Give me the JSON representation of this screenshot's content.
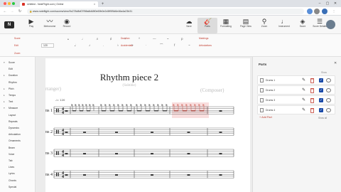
{
  "browser": {
    "tab_title": "Untitled - NoteFlight.com | Online",
    "tab_close": "×",
    "new_tab": "+",
    "url": "www.noteflight.com/scores/view/9c278d8d07f98a8d48f0e69b0e2c5ff0f5d6e46a4a23b31",
    "win_min": "–",
    "win_max": "▢",
    "win_close": "✕",
    "nav_back": "←",
    "nav_forward": "→",
    "nav_reload": "↻",
    "lock": "🔒"
  },
  "app": {
    "logo": "N",
    "tools": [
      {
        "icon": "play-icon",
        "glyph": "▶",
        "label": "Play"
      },
      {
        "icon": "metronome-icon",
        "glyph": "〰",
        "label": "Metronome"
      },
      {
        "icon": "record-icon",
        "glyph": "◉",
        "label": "Record"
      },
      {
        "icon": "save-icon",
        "glyph": "☁",
        "label": "Save"
      },
      {
        "icon": "guitar-icon",
        "glyph": "🎸",
        "label": "Parts"
      },
      {
        "icon": "formatting-icon",
        "glyph": "▦",
        "label": "Formatting"
      },
      {
        "icon": "page-view-icon",
        "glyph": "▤",
        "label": "Page View"
      },
      {
        "icon": "zoom-icon",
        "glyph": "⚲",
        "label": "Zoom"
      },
      {
        "icon": "instrument-icon",
        "glyph": "♩",
        "label": "Instrument"
      },
      {
        "icon": "score-icon",
        "glyph": "◈",
        "label": "Score"
      },
      {
        "icon": "score-details-icon",
        "glyph": "☰",
        "label": "Score Details"
      }
    ]
  },
  "subtoolbar": {
    "labels": [
      "Score",
      "Edit",
      "Zoom",
      "Notation"
    ],
    "zoom_value": "120",
    "duration_label": "Duration",
    "accidentals_label": "Accidentals",
    "markings_label": "Markings",
    "articulations_label": "Articulations"
  },
  "left_panel": {
    "items": [
      {
        "label": "Score",
        "caret": "▾"
      },
      {
        "label": "Edit",
        "caret": ""
      },
      {
        "label": "Duration",
        "caret": "▸"
      },
      {
        "label": "Rhythm",
        "caret": ""
      },
      {
        "label": "Pitch",
        "caret": "▸"
      },
      {
        "label": "Tempo",
        "caret": "▸"
      },
      {
        "label": "Text",
        "caret": "▸"
      },
      {
        "label": "Measure",
        "caret": "▾"
      },
      {
        "label": "Layout",
        "caret": ""
      },
      {
        "label": "Repeats",
        "caret": ""
      },
      {
        "label": "Dynamics",
        "caret": ""
      },
      {
        "label": "Articulation",
        "caret": ""
      },
      {
        "label": "Ornaments",
        "caret": ""
      },
      {
        "label": "Beam",
        "caret": ""
      },
      {
        "label": "Voice",
        "caret": ""
      },
      {
        "label": "Tab",
        "caret": ""
      },
      {
        "label": "Lines",
        "caret": ""
      },
      {
        "label": "Lyrics",
        "caret": ""
      },
      {
        "label": "Chords",
        "caret": ""
      },
      {
        "label": "Special",
        "caret": ""
      }
    ]
  },
  "score": {
    "title": "Rhythm piece 2",
    "subtitle": "(Subtitle)",
    "arranger": "(Arranger)",
    "composer": "(Composer)",
    "tempo_mark": "♩= 120",
    "staves": [
      {
        "label": "Drums 1",
        "top": "Drums 1"
      },
      {
        "label": "Drums 2"
      },
      {
        "label": "Drums 3"
      },
      {
        "label": "Drums 4"
      }
    ],
    "time_sig_top": "4",
    "time_sig_bottom": "4"
  },
  "parts_panel": {
    "title": "Parts",
    "close": "✕",
    "col_header": "Show",
    "parts": [
      "Drums 1",
      "Drums 2",
      "Drums 3",
      "Drums 4"
    ],
    "add_part": "+ Add Part",
    "show_all": "Show all",
    "check": "✓",
    "pen": "✎"
  }
}
